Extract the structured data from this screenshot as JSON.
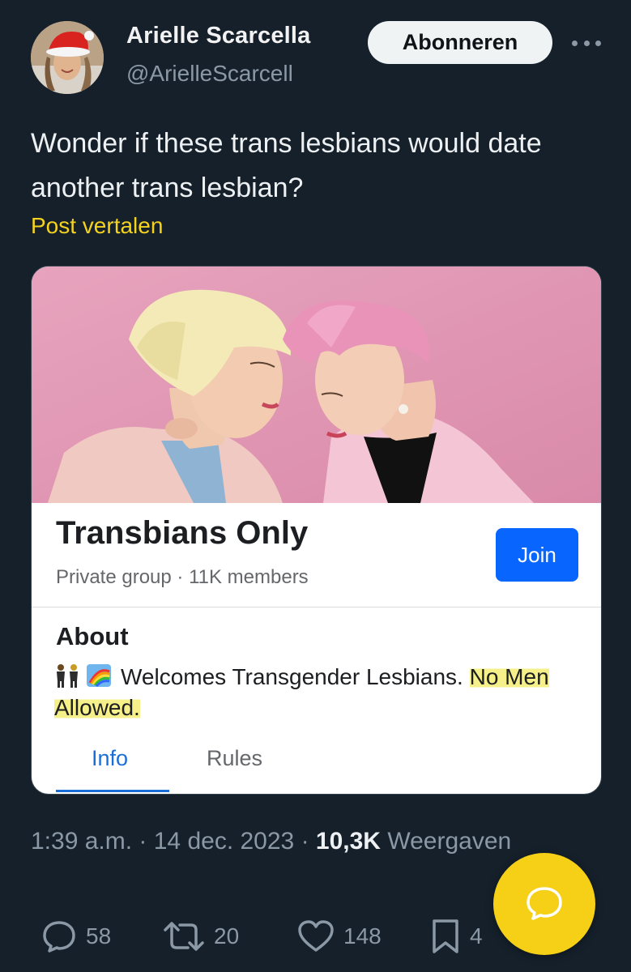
{
  "author": {
    "name": "Arielle Scarcella",
    "handle": "@ArielleScarcell",
    "subscribe_label": "Abonneren",
    "more_icon": "more-horizontal-icon"
  },
  "tweet": {
    "text": "Wonder if these trans lesbians would date another trans lesbian?",
    "translate_label": "Post vertalen"
  },
  "card": {
    "group_name": "Transbians Only",
    "group_meta": "Private group · 11K members",
    "join_label": "Join",
    "about_title": "About",
    "about_text_lead": "Welcomes Transgender Lesbians.",
    "about_text_highlight": "No Men Allowed.",
    "tabs": [
      {
        "label": "Info",
        "active": true
      },
      {
        "label": "Rules",
        "active": false
      }
    ],
    "highlight_color": "#f6f08a"
  },
  "meta": {
    "time": "1:39 a.m.",
    "date": "14 dec. 2023",
    "views_count": "10,3K",
    "views_label": "Weergaven"
  },
  "actions": {
    "replies": "58",
    "reposts": "20",
    "likes": "148",
    "bookmarks": "4"
  },
  "colors": {
    "background": "#15202b",
    "accent_yellow": "#f5d016",
    "link_yellow": "#f4d21e",
    "facebook_blue": "#0866ff"
  }
}
